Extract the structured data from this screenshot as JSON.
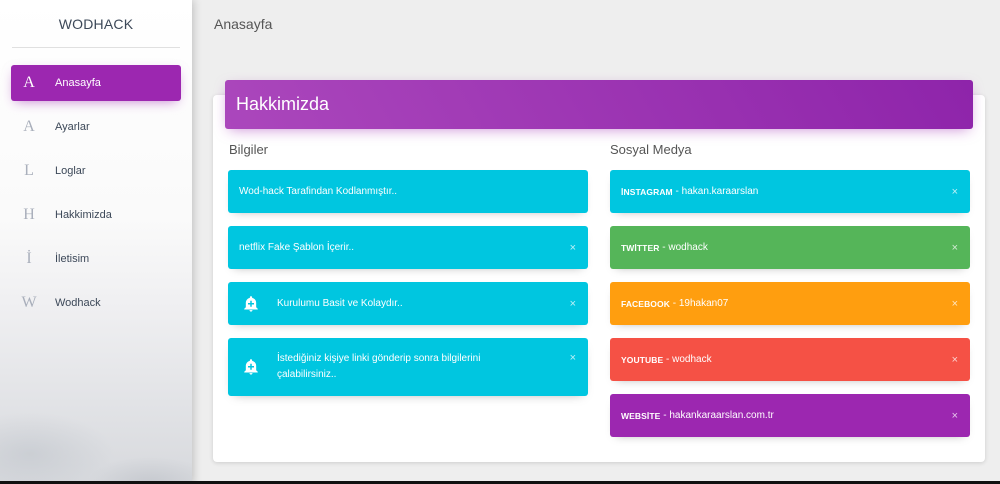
{
  "sidebar": {
    "brand": "WODHACK",
    "items": [
      {
        "letter": "A",
        "label": "Anasayfa"
      },
      {
        "letter": "A",
        "label": "Ayarlar"
      },
      {
        "letter": "L",
        "label": "Loglar"
      },
      {
        "letter": "H",
        "label": "Hakkimizda"
      },
      {
        "letter": "İ",
        "label": "İletisim"
      },
      {
        "letter": "W",
        "label": "Wodhack"
      }
    ]
  },
  "topbar": {
    "title": "Anasayfa"
  },
  "card": {
    "title": "Hakkimizda",
    "left": {
      "title": "Bilgiler",
      "alerts": [
        {
          "text": "Wod-hack Tarafindan Kodlanmıştır.."
        },
        {
          "text": "netflix Fake Şablon İçerir..",
          "close": "×"
        },
        {
          "text": "Kurulumu Basit ve Kolaydır..",
          "close": "×",
          "icon": "add-alert-icon"
        },
        {
          "text": "İstediğiniz kişiye linki gönderip sonra bilgilerini çalabilirsiniz..",
          "close": "×",
          "icon": "add-alert-icon"
        }
      ]
    },
    "right": {
      "title": "Sosyal Medya",
      "alerts": [
        {
          "label": "İNSTAGRAM",
          "text": " - hakan.karaarslan",
          "close": "×",
          "color": "#00c6e0"
        },
        {
          "label": "TWİTTER",
          "text": " - wodhack",
          "close": "×",
          "color": "#55b559"
        },
        {
          "label": "FACEBOOK",
          "text": " - 19hakan07",
          "close": "×",
          "color": "#ff9e0f"
        },
        {
          "label": "YOUTUBE",
          "text": " - wodhack",
          "close": "×",
          "color": "#f55145"
        },
        {
          "label": "WEBSİTE",
          "text": " - hakankaraarslan.com.tr",
          "close": "×",
          "color": "#9c27b0"
        }
      ]
    }
  }
}
